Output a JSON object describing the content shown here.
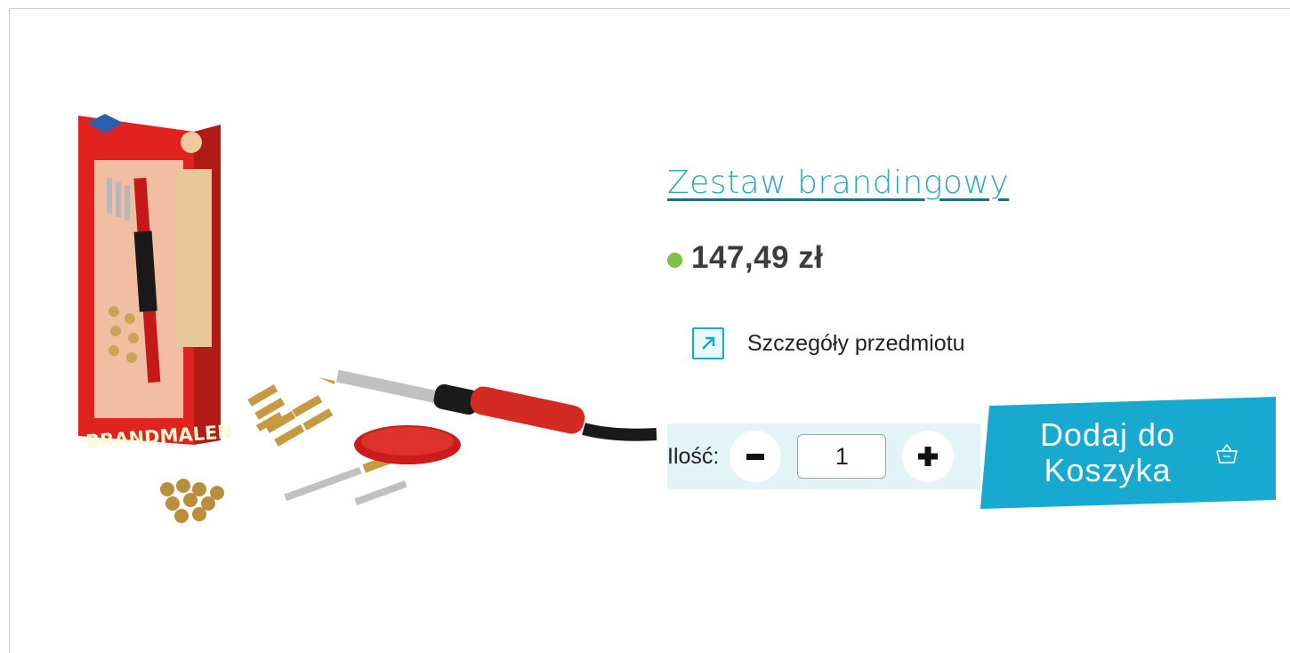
{
  "product": {
    "title": "Zestaw brandingowy",
    "price": "147,49 zł",
    "availability_color": "#7cc142",
    "details_link": "Szczegóły przedmiotu",
    "image_text": "BRANDMALEN"
  },
  "quantity": {
    "label": "Ilość:",
    "value": "1",
    "decrement_icon": "minus-icon",
    "increment_icon": "plus-icon"
  },
  "cart": {
    "button_label": "Dodaj do Koszyka",
    "icon": "basket-icon"
  },
  "colors": {
    "accent": "#17a9cf",
    "title_link": "#2aa6c8",
    "qty_background": "#e3f4f9"
  }
}
